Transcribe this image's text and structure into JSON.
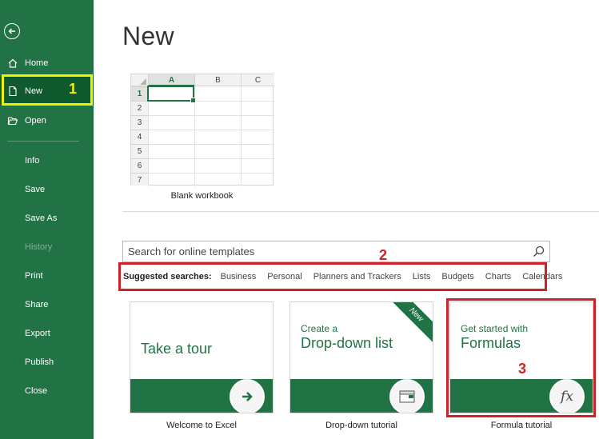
{
  "sidebar": {
    "back_icon": "arrow-left-circle-icon",
    "items": [
      {
        "label": "Home",
        "icon": "home-icon"
      },
      {
        "label": "New",
        "icon": "new-file-icon",
        "active": true
      },
      {
        "label": "Open",
        "icon": "open-folder-icon"
      },
      {
        "label": "Info"
      },
      {
        "label": "Save"
      },
      {
        "label": "Save As"
      },
      {
        "label": "History",
        "disabled": true
      },
      {
        "label": "Print"
      },
      {
        "label": "Share"
      },
      {
        "label": "Export"
      },
      {
        "label": "Publish"
      },
      {
        "label": "Close"
      }
    ]
  },
  "annotations": {
    "one": "1",
    "two": "2",
    "three": "3"
  },
  "main": {
    "title": "New",
    "blank_workbook": {
      "caption": "Blank workbook",
      "columns": [
        "A",
        "B",
        "C"
      ],
      "rows": [
        "1",
        "2",
        "3",
        "4",
        "5",
        "6",
        "7"
      ]
    },
    "search": {
      "placeholder": "Search for online templates"
    },
    "suggested": {
      "label": "Suggested searches:",
      "tags": [
        "Business",
        "Personal",
        "Planners and Trackers",
        "Lists",
        "Budgets",
        "Charts",
        "Calendars"
      ]
    },
    "tiles": [
      {
        "big": "Take a tour",
        "caption": "Welcome to Excel"
      },
      {
        "small": "Create a",
        "big": "Drop-down list",
        "badge": "New",
        "caption": "Drop-down tutorial"
      },
      {
        "small": "Get started with",
        "big": "Formulas",
        "caption": "Formula tutorial",
        "fx": "fx"
      }
    ]
  },
  "colors": {
    "accent": "#217346",
    "highlight_yellow": "#f2f200",
    "highlight_red": "#d0202a"
  }
}
